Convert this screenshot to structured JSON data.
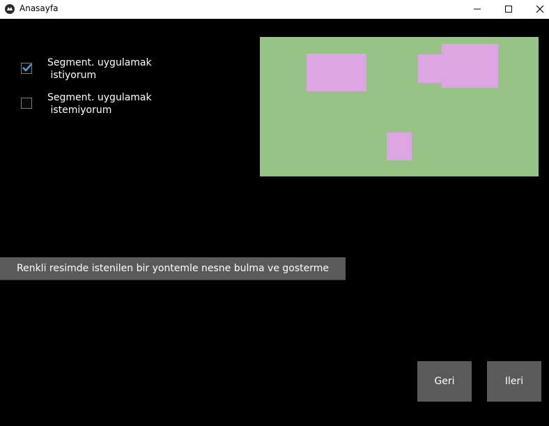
{
  "window": {
    "title": "Anasayfa",
    "icon": "kivy-logo-icon",
    "controls": [
      "minimize-icon",
      "maximize-icon",
      "close-icon"
    ]
  },
  "options": [
    {
      "label": "Segment. uygulamak\n istiyorum",
      "checked": true
    },
    {
      "label": "Segment. uygulamak\n istemiyorum",
      "checked": false
    }
  ],
  "preview": {
    "background_color": "#98c386",
    "object_color": "#dba6e2"
  },
  "action": {
    "label": "Renkli resimde istenilen bir yontemle nesne bulma ve gosterme"
  },
  "nav": {
    "back_label": "Geri",
    "next_label": "Ileri"
  },
  "colors": {
    "background": "#000000",
    "button": "#5a5a5a",
    "check_accent": "#4aa3e6"
  }
}
